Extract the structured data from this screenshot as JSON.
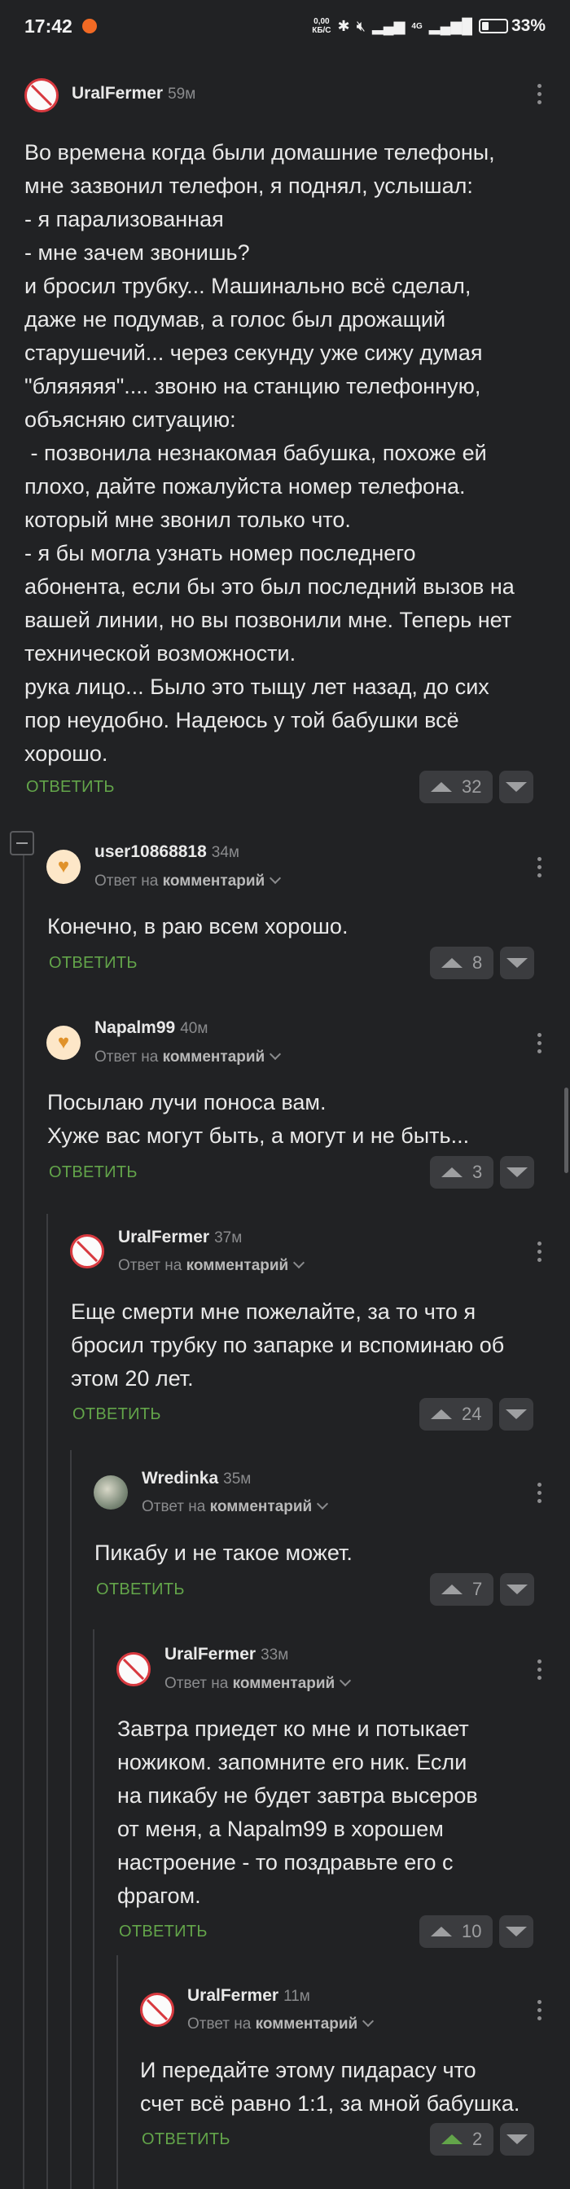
{
  "status_bar": {
    "time": "17:42",
    "net_speed_value": "0,00",
    "net_speed_unit": "КБ/С",
    "network": "4G",
    "battery": "33%"
  },
  "comments": [
    {
      "author": "UralFermer",
      "time": "59м",
      "avatar": "ban-icon",
      "text": "Во времена когда были домашние телефоны,\nмне зазвонил телефон, я поднял, услышал:\n- я парализованная\n- мне зачем звонишь?\nи бросил трубку... Машинально всё сделал,\nдаже не подумав, а голос был дрожащий\nстарушечий... через секунду уже сижу думая\n\"бляяяяя\".... звоню на станцию телефонную,\nобъясняю ситуацию:\n - позвонила незнакомая бабушка, похоже ей\nплохо, дайте пожалуйста номер телефона.\nкоторый мне звонил только что.\n- я бы могла узнать номер последнего\nабонента, если бы это был последний вызов на\nвашей линии, но вы позвонили мне. Теперь нет\nтехнической возможности.\nрука лицо... Было это тыщу лет назад, до сих\nпор неудобно. Надеюсь у той бабушки всё\nхорошо.",
      "reply_label": "ОТВЕТИТЬ",
      "votes": "32"
    },
    {
      "author": "user10868818",
      "time": "34м",
      "avatar": "cat-icon",
      "reply_to_prefix": "Ответ на",
      "reply_to_target": "комментарий",
      "text": "Конечно, в раю всем хорошо.",
      "reply_label": "ОТВЕТИТЬ",
      "votes": "8"
    },
    {
      "author": "Napalm99",
      "time": "40м",
      "avatar": "cat-icon",
      "reply_to_prefix": "Ответ на",
      "reply_to_target": "комментарий",
      "text": "Посылаю лучи поноса вам.\nХуже вас могут быть, а могут и не быть...",
      "reply_label": "ОТВЕТИТЬ",
      "votes": "3"
    },
    {
      "author": "UralFermer",
      "time": "37м",
      "avatar": "ban-icon",
      "reply_to_prefix": "Ответ на",
      "reply_to_target": "комментарий",
      "text": "Еще смерти мне пожелайте, за то что я\nбросил трубку по запарке и вспоминаю об\nэтом 20 лет.",
      "reply_label": "ОТВЕТИТЬ",
      "votes": "24"
    },
    {
      "author": "Wredinka",
      "time": "35м",
      "avatar": "photo-avatar",
      "reply_to_prefix": "Ответ на",
      "reply_to_target": "комментарий",
      "text": "Пикабу и не такое может.",
      "reply_label": "ОТВЕТИТЬ",
      "votes": "7"
    },
    {
      "author": "UralFermer",
      "time": "33м",
      "avatar": "ban-icon",
      "reply_to_prefix": "Ответ на",
      "reply_to_target": "комментарий",
      "text": "Завтра приедет ко мне и потыкает\nножиком. запомните его ник. Если\nна пикабу не будет завтра высеров\nот меня, а Napalm99 в хорошем\nнастроение - то поздравьте его с\nфрагом.",
      "reply_label": "ОТВЕТИТЬ",
      "votes": "10"
    },
    {
      "author": "UralFermer",
      "time": "11м",
      "avatar": "ban-icon",
      "reply_to_prefix": "Ответ на",
      "reply_to_target": "комментарий",
      "text": "И передайте этому пидарасу что\nсчет всё равно 1:1, за мной бабушка.",
      "reply_label": "ОТВЕТИТЬ",
      "votes": "2",
      "upvoted": true
    }
  ],
  "colors": {
    "background": "#212224",
    "reply_green": "#63a54a",
    "ban_red": "#d8393f"
  }
}
